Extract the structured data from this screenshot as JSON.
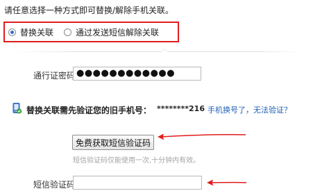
{
  "intro": "请任意选择一种方式即可替换/解除手机关联。",
  "options": [
    {
      "label": "替换关联",
      "checked": true
    },
    {
      "label": "通过发送短信解除关联",
      "checked": false
    }
  ],
  "password": {
    "label": "通行证密码：",
    "value": "●●●●●●●●●●●●"
  },
  "verify": {
    "icon": "phone-check-icon",
    "heading": "替换关联需先验证您的旧手机号：",
    "number": "********216",
    "link": "手机换号了，无法验证？"
  },
  "sms": {
    "button_label": "免费获取短信验证码",
    "hint": "短信验证码仅能使用一次,十分钟内有效。"
  },
  "code": {
    "label": "短信验证码："
  },
  "colors": {
    "highlight_box": "#e21b1b",
    "annotation_arrow": "#e21b1b",
    "link": "#1e5fb4"
  }
}
